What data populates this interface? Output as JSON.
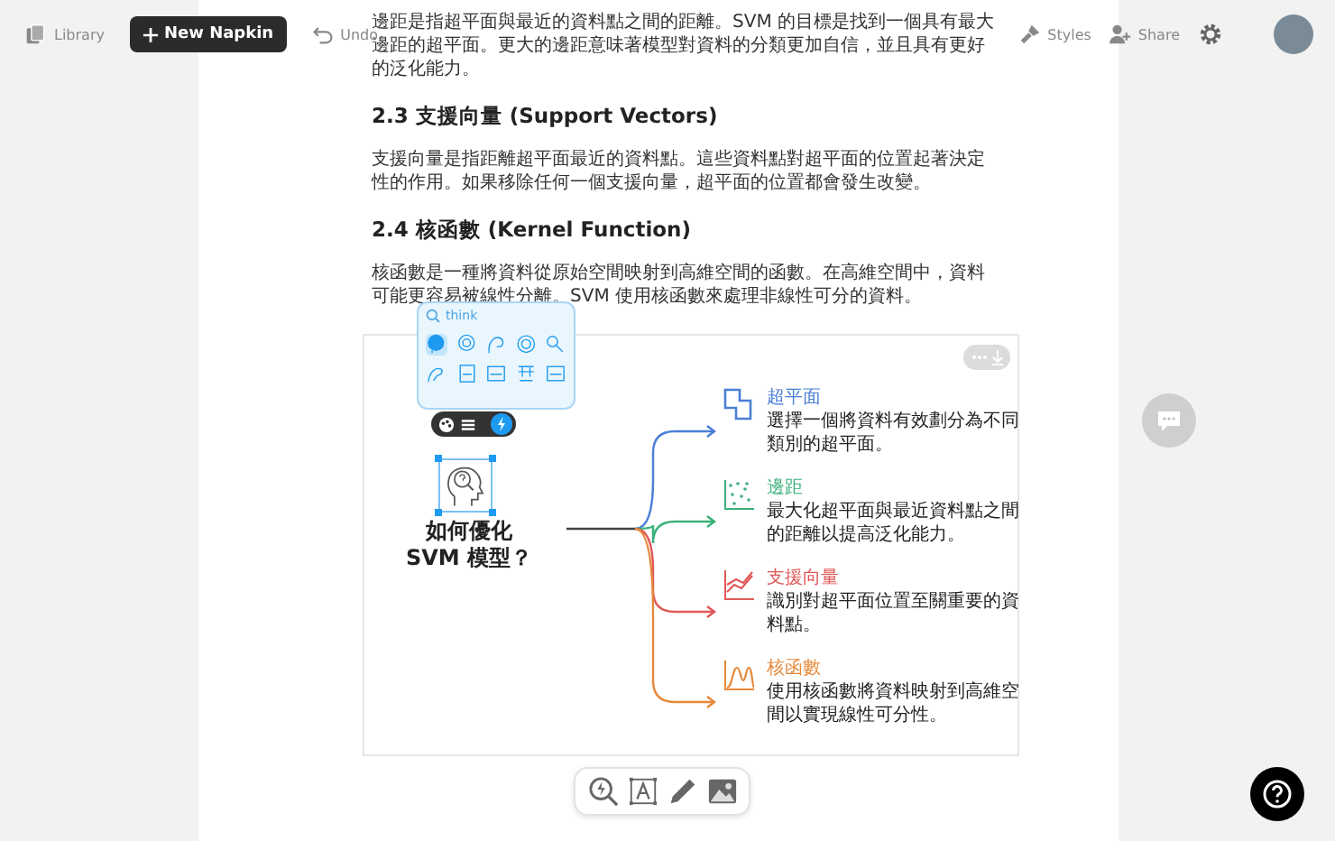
{
  "toolbar": {
    "library": "Library",
    "new_button": "New Napkin",
    "undo": "Undo",
    "styles": "Styles",
    "share": "Share"
  },
  "document": {
    "blocks": [
      {
        "kind": "paragraph",
        "text": "邊距是指超平面與最近的資料點之間的距離。SVM 的目標是找到一個具有最大邊距的超平面。更大的邊距意味著模型對資料的分類更加自信，並且具有更好的泛化能力。"
      },
      {
        "kind": "heading",
        "text": "2.3 支援向量 (Support Vectors)"
      },
      {
        "kind": "paragraph",
        "text": "支援向量是指距離超平面最近的資料點。這些資料點對超平面的位置起著決定性的作用。如果移除任何一個支援向量，超平面的位置都會發生改變。"
      },
      {
        "kind": "heading",
        "text": "2.4 核函數 (Kernel Function)"
      },
      {
        "kind": "paragraph",
        "text": "核函數是一種將資料從原始空間映射到高維空間的函數。在高維空間中，資料可能更容易被線性分離。SVM 使用核函數來處理非線性可分的資料。"
      }
    ]
  },
  "diagram": {
    "icon_panel": {
      "label": "think",
      "options": [
        {
          "selected": true
        },
        {
          "selected": false
        },
        {
          "selected": false
        },
        {
          "selected": false
        },
        {
          "selected": false
        },
        {
          "selected": false
        },
        {
          "selected": false
        },
        {
          "selected": false
        },
        {
          "selected": false
        },
        {
          "selected": false
        }
      ]
    },
    "center_lines": [
      "如何優化",
      "SVM 模型？"
    ],
    "branches": [
      {
        "kind": "shape",
        "title": "超平面",
        "text": "選擇一個將資料有效劃分為不同類別的超平面。",
        "color": "#4a7fd6"
      },
      {
        "kind": "scatter",
        "title": "邊距",
        "text": "最大化超平面與最近資料點之間的距離以提高泛化能力。",
        "color": "#3bb07a"
      },
      {
        "kind": "line-chart",
        "title": "支援向量",
        "text": "識別對超平面位置至關重要的資料點。",
        "color": "#e05858"
      },
      {
        "kind": "curve",
        "title": "核函數",
        "text": "使用核函數將資料映射到高維空間以實現線性可分性。",
        "color": "#e6893a"
      }
    ]
  }
}
